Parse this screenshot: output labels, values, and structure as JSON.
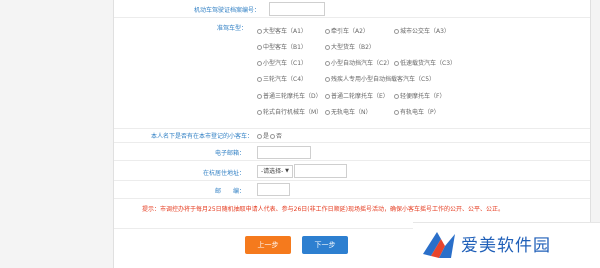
{
  "form": {
    "license_number": {
      "label": "机动车驾驶证档案编号："
    },
    "vehicle_type": {
      "label": "准驾车型：",
      "options": [
        [
          "大型客车（A1）",
          "牵引车（A2）",
          "城市公交车（A3）"
        ],
        [
          "中型客车（B1）",
          "大型货车（B2）"
        ],
        [
          "小型汽车（C1）",
          "小型自动挡汽车（C2）",
          "低速载货汽车（C3）"
        ],
        [
          "三轮汽车（C4）",
          "残疾人专用小型自动挡载客汽车（C5）"
        ],
        [
          "普通三轮摩托车（D）",
          "普通二轮摩托车（E）",
          "轻便摩托车（F）"
        ],
        [
          "轮式自行机械车（M）",
          "无轨电车（N）",
          "有轨电车（P）"
        ]
      ]
    },
    "registered": {
      "label": "本人名下是否有在本市登记的小客车：",
      "yes": "是",
      "no": "否"
    },
    "email": {
      "label": "电子邮箱："
    },
    "residence": {
      "label": "在杭居住地址：",
      "select_value": "-请选择-"
    },
    "postal": {
      "label": "邮　　编："
    }
  },
  "notice": "提示：市调控办将于每月25日随机抽取申请人代表、参与26日(非工作日顺延)现场摇号活动，确保小客车摇号工作的公开、公平、公正。",
  "buttons": {
    "prev": "上一步",
    "next": "下一步"
  },
  "brand": {
    "text": "爱美软件园"
  }
}
